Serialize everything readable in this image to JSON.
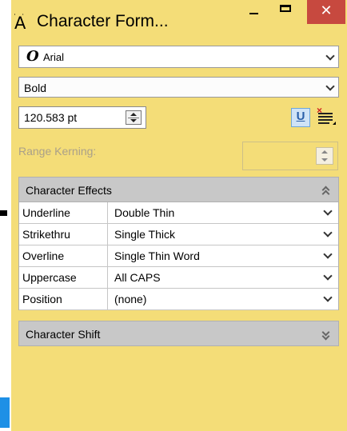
{
  "window": {
    "title": "Character Form...",
    "close_glyph": "✕"
  },
  "font": {
    "icon": "font-type-icon",
    "value": "Arial"
  },
  "weight": {
    "value": "Bold"
  },
  "size": {
    "value": "120.583 pt"
  },
  "underline_button": {
    "glyph": "U"
  },
  "kerning": {
    "label": "Range Kerning:",
    "value": ""
  },
  "character_effects": {
    "header": "Character Effects",
    "rows": [
      {
        "name": "Underline",
        "value": "Double Thin"
      },
      {
        "name": "Strikethru",
        "value": "Single Thick"
      },
      {
        "name": "Overline",
        "value": "Single Thin Word"
      },
      {
        "name": "Uppercase",
        "value": "All CAPS"
      },
      {
        "name": "Position",
        "value": "(none)"
      }
    ]
  },
  "character_shift": {
    "header": "Character Shift"
  },
  "colors": {
    "panel_background": "#f4dd78",
    "close_button": "#c7493f",
    "section_header": "#c8c8c8",
    "selected_toggle": "#cfe3f7"
  }
}
